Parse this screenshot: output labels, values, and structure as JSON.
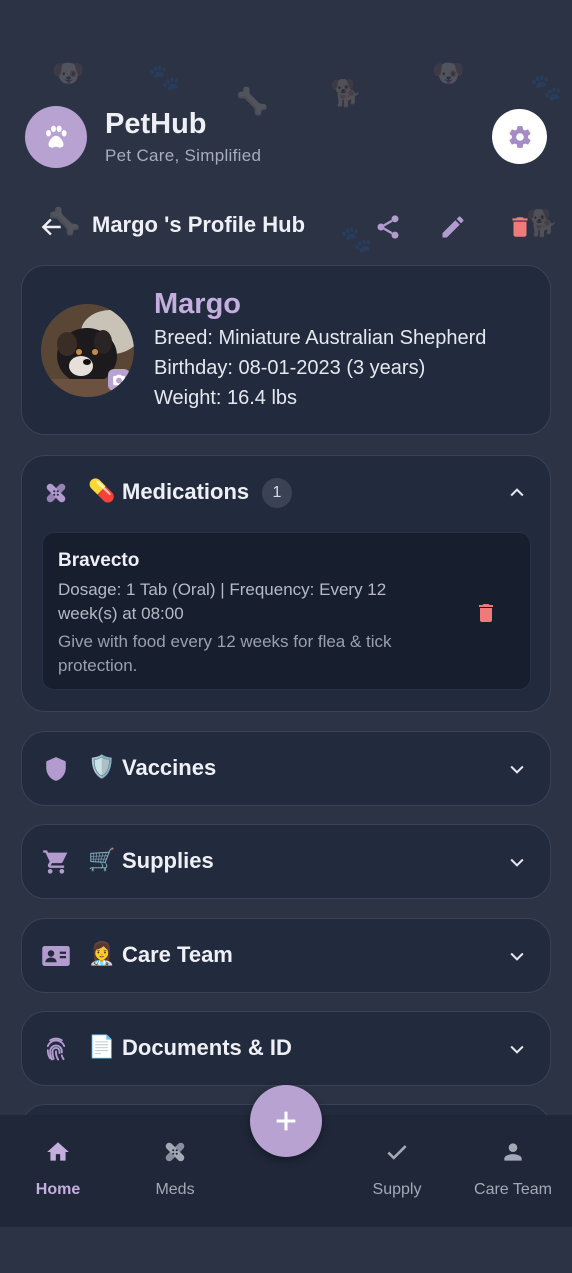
{
  "app": {
    "title": "PetHub",
    "subtitle": "Pet Care, Simplified"
  },
  "hub": {
    "title": "Margo 's Profile Hub"
  },
  "pet": {
    "name": "Margo",
    "breed": "Breed: Miniature Australian Shepherd",
    "birthday": "Birthday: 08-01-2023 (3 years)",
    "weight": "Weight: 16.4 lbs"
  },
  "sections": {
    "medications": {
      "emoji": "💊",
      "title": "Medications",
      "count": "1",
      "expanded": true,
      "items": [
        {
          "name": "Bravecto",
          "dosage": "Dosage: 1 Tab (Oral) | Frequency: Every 12 week(s) at 08:00",
          "note": "Give with food every 12 weeks for flea & tick protection."
        }
      ]
    },
    "vaccines": {
      "emoji": "🛡️",
      "title": "Vaccines"
    },
    "supplies": {
      "emoji": "🛒",
      "title": "Supplies"
    },
    "care_team": {
      "emoji": "👩‍⚕️",
      "title": "Care Team"
    },
    "documents": {
      "emoji": "📄",
      "title": "Documents & ID"
    }
  },
  "nav": {
    "items": [
      {
        "label": "Home",
        "icon": "home-icon",
        "active": true
      },
      {
        "label": "Meds",
        "icon": "bandage-icon"
      },
      {
        "label": "Supply",
        "icon": "check-icon"
      },
      {
        "label": "Care Team",
        "icon": "person-icon"
      }
    ],
    "fab_icon": "plus-icon"
  },
  "colors": {
    "background": "#2b3344",
    "card": "#222b3d",
    "accent": "#b8a2d2",
    "pet_name": "#c3aede",
    "danger": "#f07a7a"
  }
}
